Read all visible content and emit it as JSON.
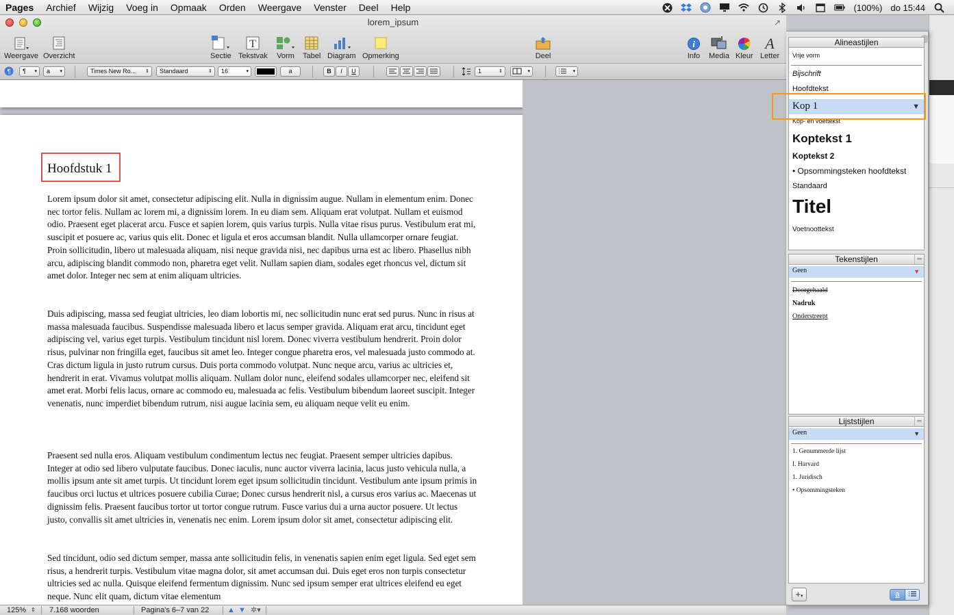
{
  "menubar": {
    "app": "Pages",
    "items": [
      "Archief",
      "Wijzig",
      "Voeg in",
      "Opmaak",
      "Orden",
      "Weergave",
      "Venster",
      "Deel",
      "Help"
    ],
    "battery": "(100%)",
    "clock": "do 15:44"
  },
  "window": {
    "title": "lorem_ipsum"
  },
  "toolbar": {
    "weergave": "Weergave",
    "overzicht": "Overzicht",
    "sectie": "Sectie",
    "tekstvak": "Tekstvak",
    "vorm": "Vorm",
    "tabel": "Tabel",
    "diagram": "Diagram",
    "opmerking": "Opmerking",
    "deel": "Deel",
    "info": "Info",
    "media": "Media",
    "kleur": "Kleur",
    "letter": "Letter"
  },
  "formatbar": {
    "paragraph_style": "¶",
    "char_style": "a",
    "font": "Times New Ro...",
    "typeface": "Standaard",
    "size": "16",
    "bg_swatch": "a",
    "bold": "B",
    "italic": "I",
    "underline": "U",
    "line_spacing": "1"
  },
  "document": {
    "heading": "Hoofdstuk 1",
    "paragraphs": [
      "Lorem ipsum dolor sit amet, consectetur adipiscing elit. Nulla in dignissim augue. Nullam in elementum enim. Donec nec tortor felis. Nullam ac lorem mi, a dignissim lorem. In eu diam sem. Aliquam erat volutpat. Nullam et euismod odio. Praesent eget placerat arcu. Fusce et sapien lorem, quis varius turpis. Nulla vitae risus purus. Vestibulum erat mi, suscipit et posuere ac, varius quis elit. Donec et ligula et eros accumsan blandit. Nulla ullamcorper ornare feugiat. Proin sollicitudin, libero ut malesuada aliquam, nisi neque gravida nisi, nec dapibus urna est ac libero. Phasellus nibh arcu, adipiscing blandit commodo non, pharetra eget velit. Nullam sapien diam, sodales eget rhoncus vel, dictum sit amet dolor. Integer nec sem at enim aliquam ultricies.",
      "Duis adipiscing, massa sed feugiat ultricies, leo diam lobortis mi, nec sollicitudin nunc erat sed purus. Nunc in risus at massa malesuada faucibus. Suspendisse malesuada libero et lacus semper gravida. Aliquam erat arcu, tincidunt eget adipiscing vel, varius eget turpis. Vestibulum tincidunt nisl lorem. Donec viverra vestibulum hendrerit. Proin dolor risus, pulvinar non fringilla eget, faucibus sit amet leo. Integer congue pharetra eros, vel malesuada justo commodo at. Cras dictum ligula in justo rutrum cursus. Duis porta commodo volutpat. Nunc neque arcu, varius ac ultricies et, hendrerit in erat. Vivamus volutpat mollis aliquam. Nullam dolor nunc, eleifend sodales ullamcorper nec, eleifend sit amet erat. Morbi felis lacus, ornare ac commodo eu, malesuada ac felis. Vestibulum bibendum laoreet suscipit. Integer venenatis, nunc imperdiet bibendum rutrum, nisi augue lacinia sem, eu aliquam neque velit eu enim.",
      "Praesent sed nulla eros. Aliquam vestibulum condimentum lectus nec feugiat. Praesent semper ultricies dapibus. Integer at odio sed libero vulputate faucibus. Donec iaculis, nunc auctor viverra lacinia, lacus justo vehicula nulla, a mollis ipsum ante sit amet turpis. Ut tincidunt lorem eget ipsum sollicitudin tincidunt. Vestibulum ante ipsum primis in faucibus orci luctus et ultrices posuere cubilia Curae; Donec cursus hendrerit nisl, a cursus eros varius ac. Maecenas ut dignissim felis. Praesent faucibus tortor ut tortor congue rutrum. Fusce varius dui a urna auctor posuere. Ut lectus justo, convallis sit amet ultricies in, venenatis nec enim. Lorem ipsum dolor sit amet, consectetur adipiscing elit.",
      "Sed tincidunt, odio sed dictum semper, massa ante sollicitudin felis, in venenatis sapien enim eget ligula. Sed eget sem risus, a hendrerit turpis. Vestibulum vitae magna dolor, sit amet accumsan dui. Duis eget eros non turpis consectetur ultricies sed ac nulla. Quisque eleifend fermentum dignissim. Nunc sed ipsum semper erat ultrices eleifend eu eget neque. Nunc elit quam, dictum vitae elementum"
    ]
  },
  "statusbar": {
    "zoom": "125%",
    "words": "7.168 woorden",
    "pages": "Pagina's 6–7 van 22"
  },
  "drawer": {
    "paragraph_header": "Alineastijlen",
    "paragraph_styles": {
      "vrije_vorm": "Vrije vorm",
      "bijschrift": "Bijschrift",
      "hoofdtekst": "Hoofdtekst",
      "kop1": "Kop 1",
      "kop_voettekst": "Kop- en voettekst",
      "koptekst1": "Koptekst 1",
      "koptekst2": "Koptekst 2",
      "opsomming": "Opsommingsteken hoofdtekst",
      "standaard": "Standaard",
      "titel": "Titel",
      "voetnoot": "Voetnoottekst"
    },
    "char_header": "Tekenstijlen",
    "char_styles": {
      "geen": "Geen",
      "doorgehaald": "Doorgehaald",
      "nadruk": "Nadruk",
      "onderstreept": "Onderstreept"
    },
    "list_header": "Lijststijlen",
    "list_styles": {
      "geen": "Geen",
      "genummerd": "1.  Genummerde lijst",
      "harvard": "I.  Harvard",
      "juridisch": "1.  Juridisch",
      "opsommingsteken": "•  Opsommingsteken"
    },
    "add_button": "+",
    "seg_char": "a"
  },
  "colors": {
    "heading_highlight": "#d9534f",
    "selected_style_highlight": "#f29a1e",
    "selection_blue": "#c7dbf5"
  }
}
